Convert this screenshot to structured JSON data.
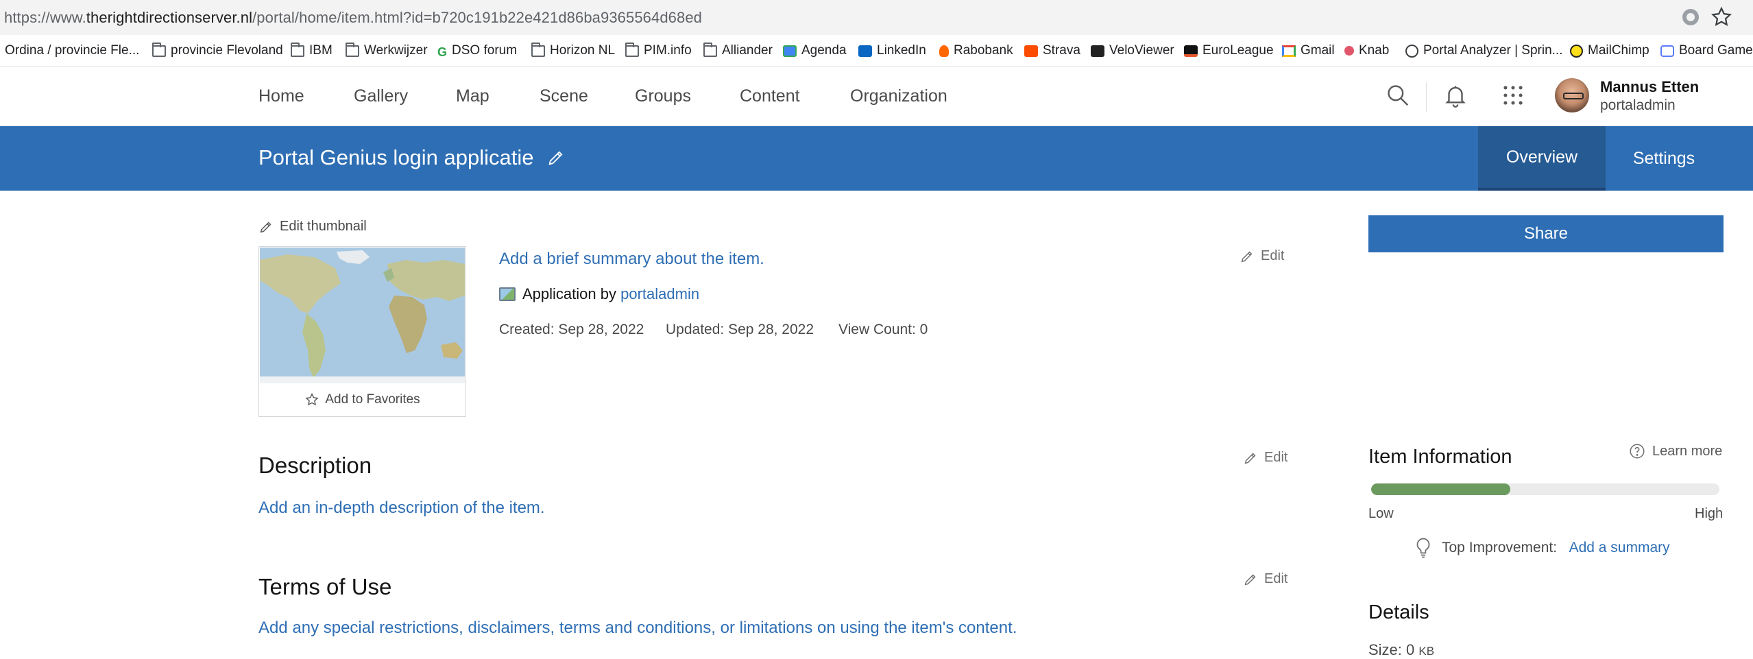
{
  "browser": {
    "url_prefix": "https://www.",
    "url_domain": "therightdirectionserver.nl",
    "url_path": "/portal/home/item.html?id=b720c191b22e421d86ba9365564d68ed",
    "extension_icon": "extension-icon",
    "bookmark_star_icon": "star-icon",
    "bookmarks": [
      {
        "label": "Ordina / provincie Fle...",
        "icon": "folder-icon"
      },
      {
        "label": "provincie Flevoland",
        "icon": "folder-icon"
      },
      {
        "label": "IBM",
        "icon": "folder-icon"
      },
      {
        "label": "Werkwijzer",
        "icon": "folder-icon"
      },
      {
        "label": "DSO forum",
        "icon": "dso-icon"
      },
      {
        "label": "Horizon NL",
        "icon": "folder-icon"
      },
      {
        "label": "PIM.info",
        "icon": "folder-icon"
      },
      {
        "label": "Alliander",
        "icon": "folder-icon"
      },
      {
        "label": "Agenda",
        "icon": "calendar-icon"
      },
      {
        "label": "LinkedIn",
        "icon": "linkedin-icon"
      },
      {
        "label": "Rabobank",
        "icon": "rabobank-icon"
      },
      {
        "label": "Strava",
        "icon": "strava-icon"
      },
      {
        "label": "VeloViewer",
        "icon": "veloviewer-icon"
      },
      {
        "label": "EuroLeague",
        "icon": "euroleague-icon"
      },
      {
        "label": "Gmail",
        "icon": "gmail-icon"
      },
      {
        "label": "Knab",
        "icon": "knab-icon"
      },
      {
        "label": "Portal Analyzer | Sprin...",
        "icon": "globe-icon"
      },
      {
        "label": "MailChimp",
        "icon": "mailchimp-icon"
      },
      {
        "label": "Board Game",
        "icon": "board-game-icon"
      }
    ]
  },
  "nav": {
    "items": [
      "Home",
      "Gallery",
      "Map",
      "Scene",
      "Groups",
      "Content",
      "Organization"
    ],
    "user_name": "Mannus Etten",
    "user_login": "portaladmin"
  },
  "item": {
    "title": "Portal Genius login applicatie",
    "tabs": [
      "Overview",
      "Settings"
    ],
    "active_tab": "Overview",
    "edit_thumbnail": "Edit thumbnail",
    "add_to_favorites": "Add to Favorites",
    "summary_placeholder": "Add a brief summary about the item.",
    "type_label": "Application by",
    "owner": "portaladmin",
    "created": "Created: Sep 28, 2022",
    "updated": "Updated: Sep 28, 2022",
    "view_count": "View Count: 0",
    "edit_label": "Edit"
  },
  "description": {
    "title": "Description",
    "placeholder": "Add an in-depth description of the item."
  },
  "terms": {
    "title": "Terms of Use",
    "placeholder": "Add any special restrictions, disclaimers, terms and conditions, or limitations on using the item's content."
  },
  "sidebar": {
    "share": "Share",
    "item_information": "Item Information",
    "learn_more": "Learn more",
    "info_score_fraction": 0.4,
    "low": "Low",
    "high": "High",
    "top_improvement_label": "Top Improvement:",
    "top_improvement_link": "Add a summary",
    "details_title": "Details",
    "size_label": "Size: 0",
    "size_unit": "KB"
  },
  "colors": {
    "brand_blue": "#2e6eb4",
    "active_tab": "#255a93",
    "progress_green": "#6b9a5e"
  }
}
